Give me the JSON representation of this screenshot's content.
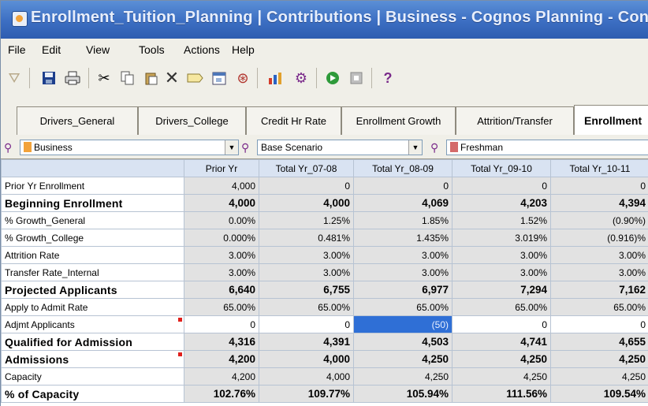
{
  "window": {
    "title": "Enrollment_Tuition_Planning | Contributions | Business - Cognos Planning - Contributor"
  },
  "menu": [
    "File",
    "Edit",
    "View",
    "Tools",
    "Actions",
    "Help"
  ],
  "toolbar": {
    "icons": [
      "filter-icon",
      "save-icon",
      "print-icon",
      "cut-icon",
      "copy-icon",
      "paste-icon",
      "delete-icon",
      "comment-icon",
      "calendar-icon",
      "lock-icon",
      "chart-icon",
      "tools-icon",
      "go-icon",
      "stop-icon",
      "help-icon"
    ],
    "help_label": "?"
  },
  "tabs": [
    "Drivers_General",
    "Drivers_College",
    "Credit Hr Rate",
    "Enrollment Growth",
    "Attrition/Transfer",
    "Enrollment"
  ],
  "active_tab": "Enrollment",
  "selectors": {
    "entity": "Business",
    "scenario": "Base Scenario",
    "level": "Freshman"
  },
  "grid": {
    "columns": [
      "Prior Yr",
      "Total Yr_07-08",
      "Total Yr_08-09",
      "Total Yr_09-10",
      "Total Yr_10-11"
    ],
    "rows": [
      {
        "label": "Prior Yr Enrollment",
        "bold": false,
        "values": [
          "4,000",
          "0",
          "0",
          "0",
          "0"
        ]
      },
      {
        "label": "Beginning Enrollment",
        "bold": true,
        "values": [
          "4,000",
          "4,000",
          "4,069",
          "4,203",
          "4,394"
        ]
      },
      {
        "label": "% Growth_General",
        "bold": false,
        "values": [
          "0.00%",
          "1.25%",
          "1.85%",
          "1.52%",
          "(0.90%)"
        ]
      },
      {
        "label": "% Growth_College",
        "bold": false,
        "values": [
          "0.000%",
          "0.481%",
          "1.435%",
          "3.019%",
          "(0.916)%"
        ]
      },
      {
        "label": "Attrition Rate",
        "bold": false,
        "values": [
          "3.00%",
          "3.00%",
          "3.00%",
          "3.00%",
          "3.00%"
        ]
      },
      {
        "label": "Transfer Rate_Internal",
        "bold": false,
        "values": [
          "3.00%",
          "3.00%",
          "3.00%",
          "3.00%",
          "3.00%"
        ]
      },
      {
        "label": "Projected Applicants",
        "bold": true,
        "values": [
          "6,640",
          "6,755",
          "6,977",
          "7,294",
          "7,162"
        ]
      },
      {
        "label": "Apply to Admit Rate",
        "bold": false,
        "values": [
          "65.00%",
          "65.00%",
          "65.00%",
          "65.00%",
          "65.00%"
        ]
      },
      {
        "label": "Adjmt Applicants",
        "bold": false,
        "values": [
          "0",
          "0",
          "(50)",
          "0",
          "0"
        ]
      },
      {
        "label": "Qualified for Admission",
        "bold": true,
        "values": [
          "4,316",
          "4,391",
          "4,503",
          "4,741",
          "4,655"
        ]
      },
      {
        "label": "Admissions",
        "bold": true,
        "values": [
          "4,200",
          "4,000",
          "4,250",
          "4,250",
          "4,250"
        ]
      },
      {
        "label": "Capacity",
        "bold": false,
        "values": [
          "4,200",
          "4,000",
          "4,250",
          "4,250",
          "4,250"
        ]
      },
      {
        "label": "% of Capacity",
        "bold": true,
        "values": [
          "102.76%",
          "109.77%",
          "105.94%",
          "111.56%",
          "109.54%"
        ]
      }
    ]
  },
  "colors": {
    "title_bar": "#3c6ec2",
    "header_cells": "#d9e3f2",
    "readonly_cells": "#e2e2e2",
    "selected_cell": "#2f6fd6",
    "flag": "#e0201c"
  }
}
